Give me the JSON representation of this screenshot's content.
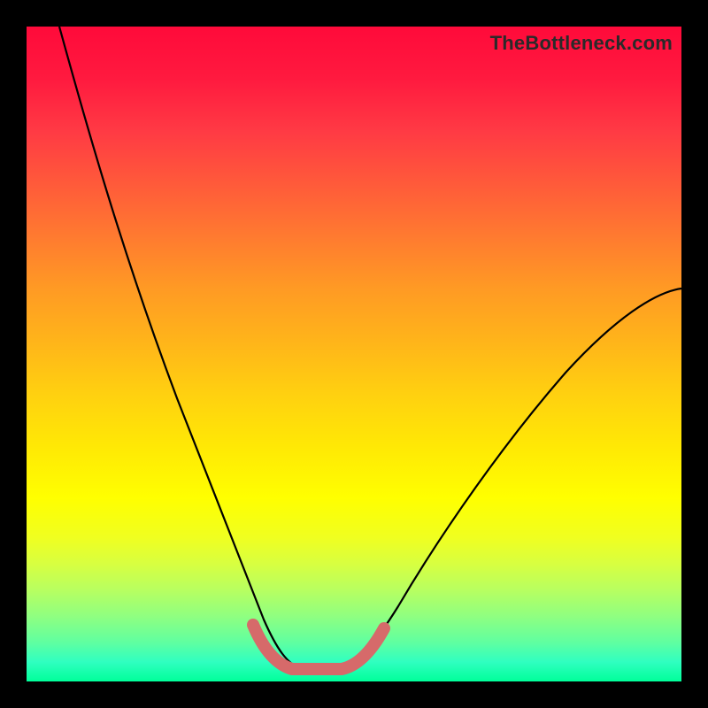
{
  "watermark": {
    "text": "TheBottleneck.com"
  },
  "chart_data": {
    "type": "line",
    "title": "",
    "xlabel": "",
    "ylabel": "",
    "xlim": [
      0,
      100
    ],
    "ylim": [
      0,
      100
    ],
    "series": [
      {
        "name": "black-curve",
        "x": [
          5,
          10,
          15,
          20,
          25,
          30,
          32,
          34,
          36,
          38,
          40,
          42,
          44,
          46,
          48,
          50,
          55,
          60,
          65,
          70,
          75,
          80,
          85,
          90,
          95,
          100
        ],
        "y": [
          100,
          86,
          72,
          58,
          45,
          32,
          27,
          22,
          17,
          12,
          8,
          5,
          3,
          2,
          2,
          3,
          8,
          15,
          23,
          31,
          39,
          46,
          52,
          56,
          59,
          60
        ]
      },
      {
        "name": "red-highlight",
        "x": [
          34,
          36,
          38,
          40,
          42,
          44,
          46,
          48,
          50,
          52
        ],
        "y": [
          11,
          8,
          5,
          3.5,
          2.5,
          2,
          2,
          2.5,
          3.5,
          6
        ]
      }
    ],
    "colors": {
      "black_curve": "#000000",
      "red_highlight": "#d66a6a",
      "gradient_top": "#ff0a3a",
      "gradient_bottom": "#00ff9a"
    }
  }
}
